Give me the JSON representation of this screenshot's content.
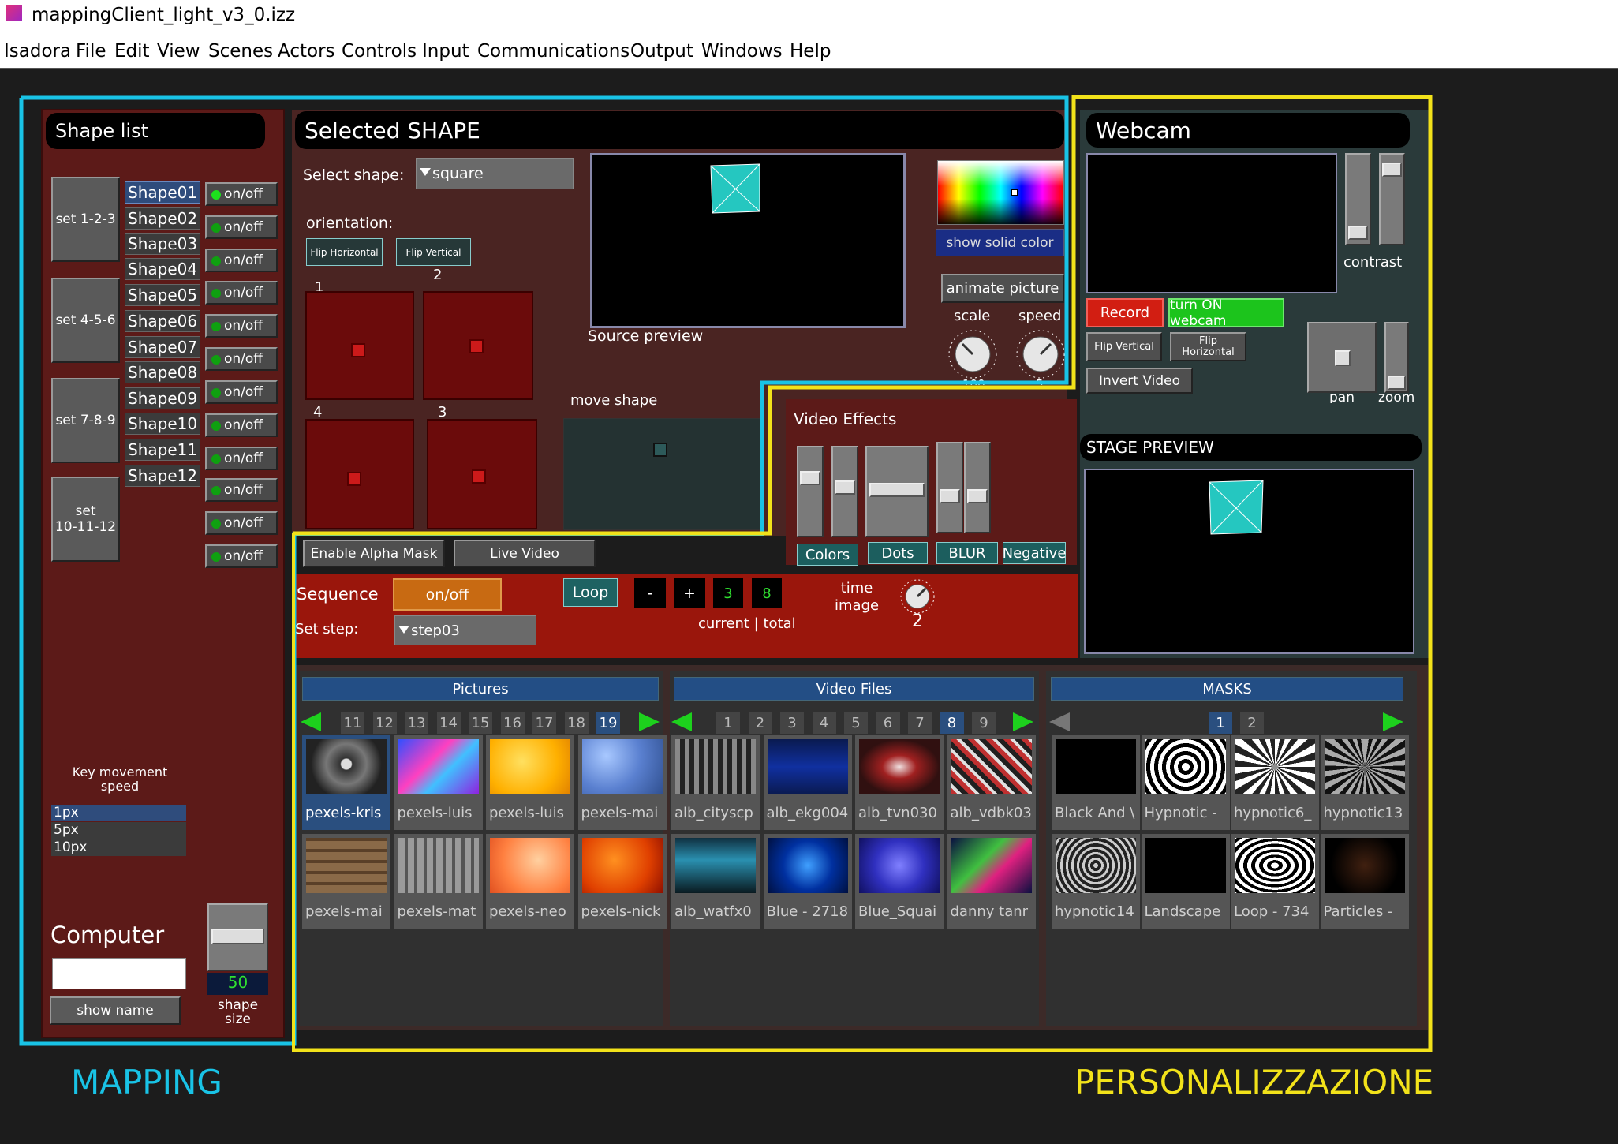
{
  "window": {
    "title": "mappingClient_light_v3_0.izz"
  },
  "menu": [
    "Isadora",
    "File",
    "Edit",
    "View",
    "Scenes",
    "Actors",
    "Controls",
    "Input",
    "Communications",
    "Output",
    "Windows",
    "Help"
  ],
  "shape_list": {
    "title": "Shape list",
    "set_buttons": [
      "set 1-2-3",
      "set 4-5-6",
      "set 7-8-9",
      "set\n10-11-12"
    ],
    "shapes": [
      "Shape01",
      "Shape02",
      "Shape03",
      "Shape04",
      "Shape05",
      "Shape06",
      "Shape07",
      "Shape08",
      "Shape09",
      "Shape10",
      "Shape11",
      "Shape12"
    ],
    "toggle_label": "on/off",
    "key_speed_label": "Key movement\nspeed",
    "speeds": [
      "1px",
      "5px",
      "10px"
    ],
    "computer_label": "Computer",
    "show_name": "show name",
    "shape_size_value": "50",
    "shape_size_label": "shape\nsize"
  },
  "selected": {
    "title": "Selected SHAPE",
    "select_label": "Select shape:",
    "select_value": "square",
    "orientation_label": "orientation:",
    "flip_h": "Flip Horizontal",
    "flip_v": "Flip Vertical",
    "corner_labels": [
      "1",
      "2",
      "4",
      "3"
    ],
    "source_preview": "Source preview",
    "show_solid_color": "show solid color",
    "animate_picture": "animate picture",
    "scale_label": "scale",
    "speed_label": "speed",
    "scale_value": "100",
    "speed_value": "5",
    "move_shape": "move shape",
    "enable_alpha": "Enable Alpha Mask",
    "live_video": "Live Video"
  },
  "video_effects": {
    "title": "Video Effects",
    "buttons": [
      "Colors",
      "Dots",
      "BLUR",
      "Negative"
    ]
  },
  "sequence": {
    "label": "Sequence",
    "onoff": "on/off",
    "loop": "Loop",
    "minus": "-",
    "plus": "+",
    "current": "3",
    "total": "8",
    "current_total_label": "current | total",
    "time_image_label": "time\nimage",
    "time_value": "2",
    "set_step_label": "Set step:",
    "step_value": "step03"
  },
  "webcam": {
    "title": "Webcam",
    "contrast": "contrast",
    "record": "Record",
    "turn_on": "turn ON webcam",
    "flip_v": "Flip Vertical",
    "flip_h": "Flip\nHorizontal",
    "invert": "Invert Video",
    "pan": "pan",
    "zoom": "zoom"
  },
  "stage": {
    "title": "STAGE PREVIEW"
  },
  "pictures": {
    "title": "Pictures",
    "pages": [
      "11",
      "12",
      "13",
      "14",
      "15",
      "16",
      "17",
      "18",
      "19"
    ],
    "active_page": "19",
    "items": [
      "pexels-kris",
      "pexels-luis",
      "pexels-luis",
      "pexels-mai",
      "pexels-mai",
      "pexels-mat",
      "pexels-neo",
      "pexels-nick"
    ]
  },
  "videos": {
    "title": "Video Files",
    "pages": [
      "1",
      "2",
      "3",
      "4",
      "5",
      "6",
      "7",
      "8",
      "9"
    ],
    "active_page": "8",
    "items": [
      "alb_cityscp",
      "alb_ekg004",
      "alb_tvn030",
      "alb_vdbk03",
      "alb_watfx0",
      "Blue - 2718",
      "Blue_Squai",
      "danny tanr"
    ]
  },
  "masks": {
    "title": "MASKS",
    "pages": [
      "1",
      "2"
    ],
    "active_page": "1",
    "items": [
      "Black And \\",
      "Hypnotic -",
      "hypnotic6_",
      "hypnotic13",
      "hypnotic14",
      "Landscape",
      "Loop - 734",
      "Particles -"
    ]
  },
  "captions": {
    "mapping": "MAPPING",
    "personal": "PERSONALIZZAZIONE"
  },
  "colors": {
    "cyan": "#19c3e6",
    "yellow": "#f2e21a",
    "panel_red": "#5c1a18",
    "seq_red": "#9a160c",
    "dark_panel": "#303030"
  }
}
